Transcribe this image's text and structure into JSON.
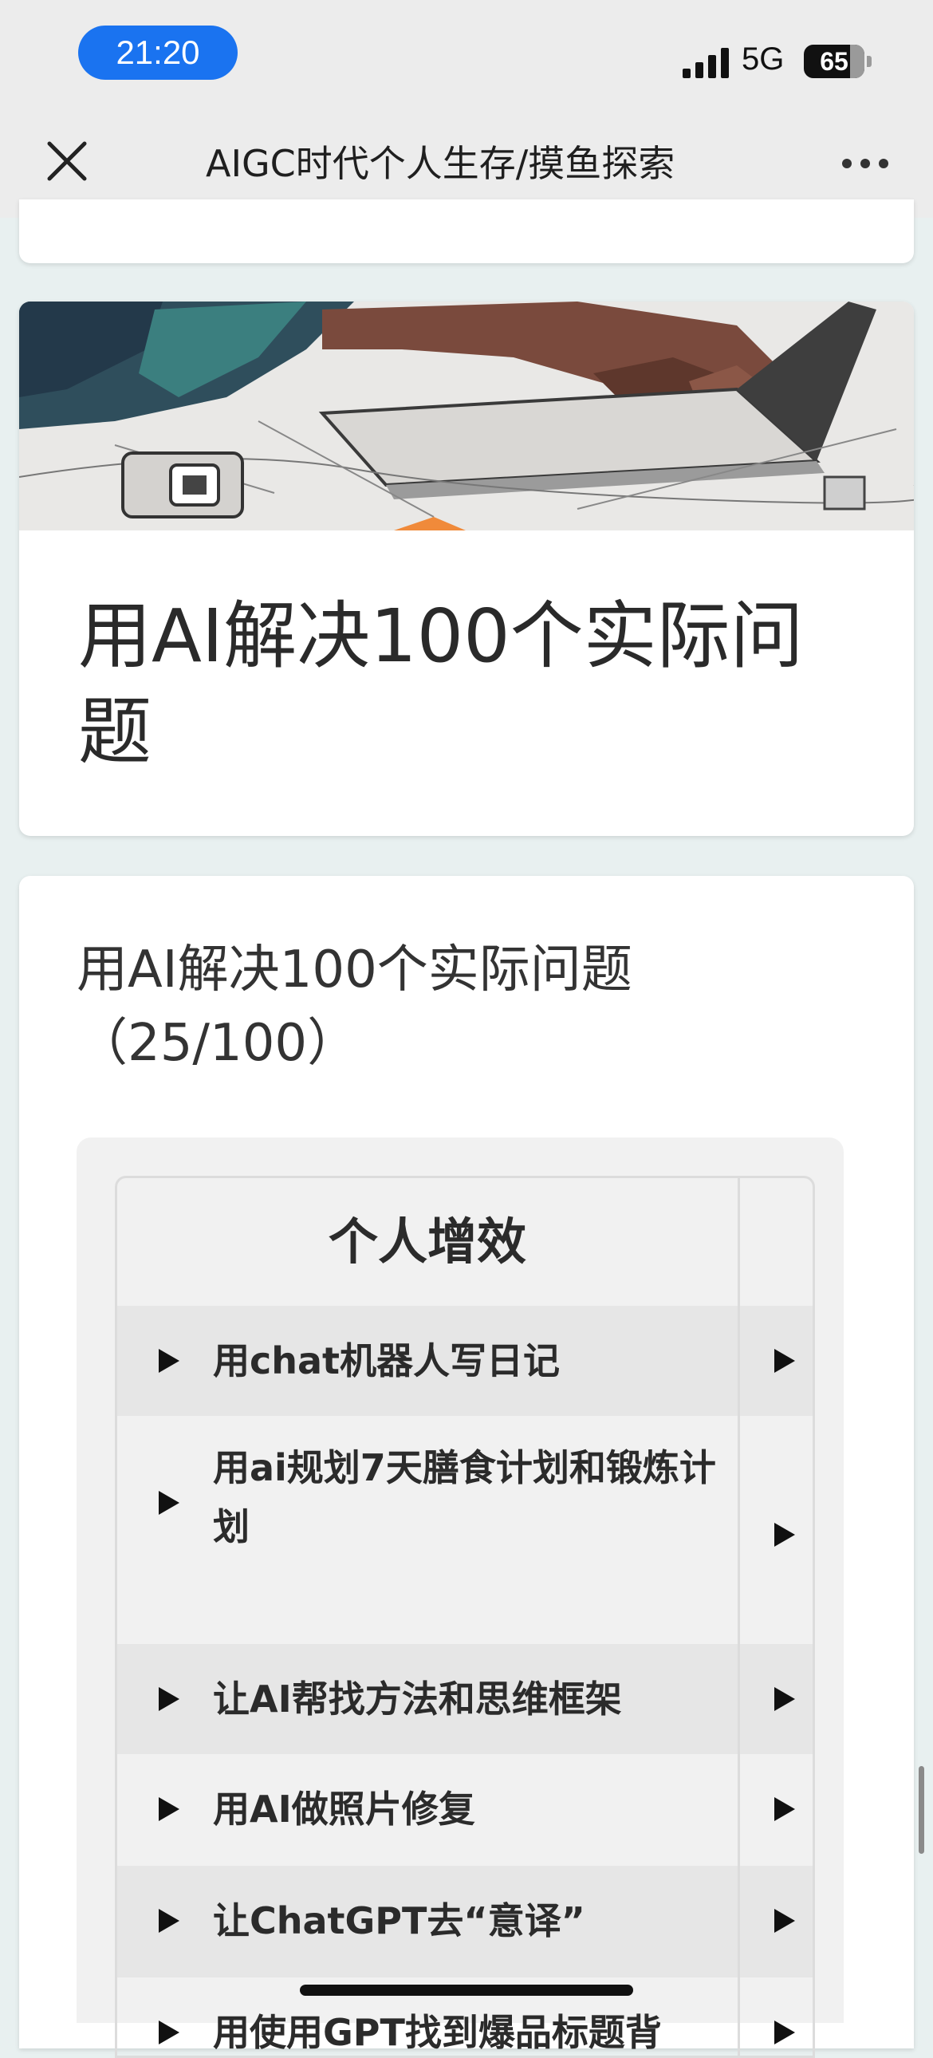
{
  "status_bar": {
    "time": "21:20",
    "network": "5G",
    "battery": "65"
  },
  "nav": {
    "title": "AIGC时代个人生存/摸鱼探索",
    "close_icon": "close-icon",
    "more_icon": "more-icon"
  },
  "image_card": {
    "title": "用AI解决100个实际问题"
  },
  "section": {
    "title": "用AI解决100个实际问题（25/100）"
  },
  "table": {
    "header": "个人增效",
    "rows": [
      {
        "label": "用chat机器人写日记"
      },
      {
        "label": "用ai规划7天膳食计划和锻炼计划"
      },
      {
        "label": "让AI帮找方法和思维框架"
      },
      {
        "label": "用AI做照片修复"
      },
      {
        "label": "让ChatGPT去“意译”"
      },
      {
        "label": "用使用GPT找到爆品标题背"
      }
    ]
  }
}
